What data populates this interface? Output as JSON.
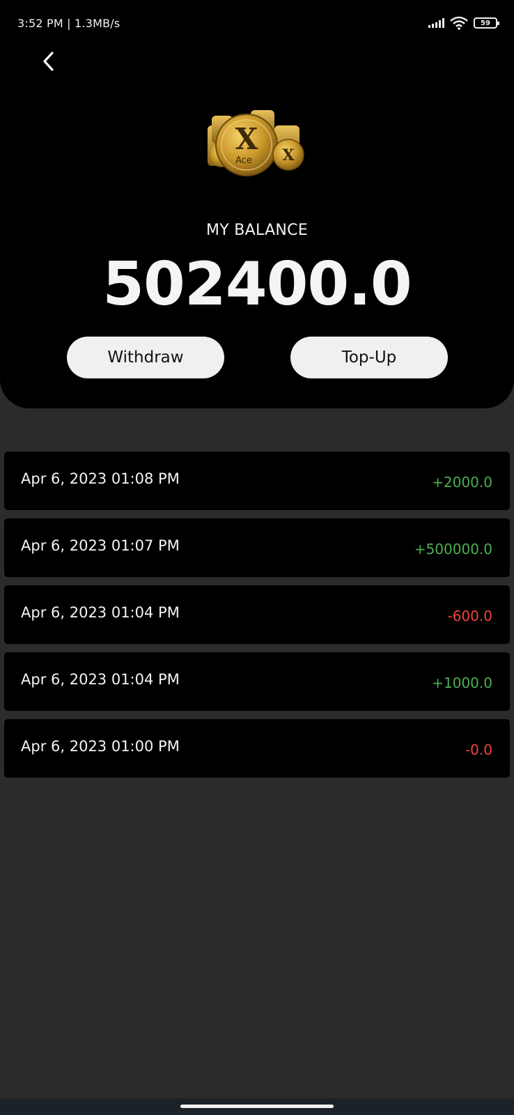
{
  "status_bar": {
    "left_text": "3:52 PM | 1.3MB/s",
    "battery": "59"
  },
  "header": {
    "logo_text": "Ace",
    "balance_label": "MY BALANCE",
    "balance_amount": "502400.0",
    "withdraw_label": "Withdraw",
    "topup_label": "Top-Up"
  },
  "transactions": [
    {
      "date": "Apr 6, 2023 01:08 PM",
      "amount": "+2000.0",
      "type": "credit"
    },
    {
      "date": "Apr 6, 2023 01:07 PM",
      "amount": "+500000.0",
      "type": "credit"
    },
    {
      "date": "Apr 6, 2023 01:04 PM",
      "amount": "-600.0",
      "type": "debit"
    },
    {
      "date": "Apr 6, 2023 01:04 PM",
      "amount": "+1000.0",
      "type": "credit"
    },
    {
      "date": "Apr 6, 2023 01:00 PM",
      "amount": "-0.0",
      "type": "debit"
    }
  ],
  "colors": {
    "credit": "#4caf50",
    "debit": "#f0443a",
    "background": "#2b2b2b",
    "card": "#000000"
  },
  "icons": {
    "back": "chevron-left-icon",
    "logo": "gold-coins-icon",
    "signal": "signal-icon",
    "wifi": "wifi-icon",
    "battery": "battery-icon"
  }
}
